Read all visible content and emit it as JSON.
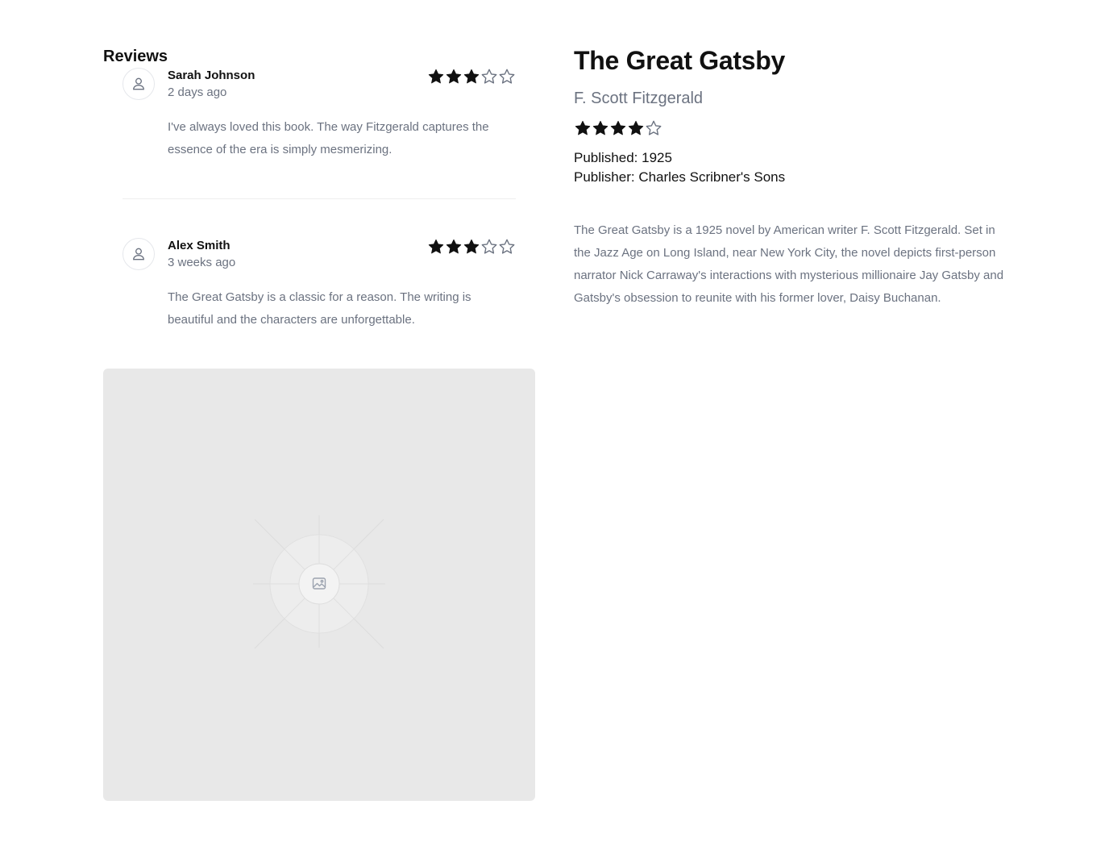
{
  "reviews_section": {
    "heading": "Reviews",
    "items": [
      {
        "name": "Sarah Johnson",
        "time": "2 days ago",
        "rating": 3,
        "max_rating": 5,
        "text": "I've always loved this book. The way Fitzgerald captures the essence of the era is simply mesmerizing."
      },
      {
        "name": "Alex Smith",
        "time": "3 weeks ago",
        "rating": 3,
        "max_rating": 5,
        "text": "The Great Gatsby is a classic for a reason. The writing is beautiful and the characters are unforgettable."
      }
    ]
  },
  "book": {
    "title": "The Great Gatsby",
    "author": "F. Scott Fitzgerald",
    "rating": 4,
    "max_rating": 5,
    "published": "Published: 1925",
    "publisher": "Publisher: Charles Scribner's Sons",
    "description": "The Great Gatsby is a 1925 novel by American writer F. Scott Fitzgerald. Set in the Jazz Age on Long Island, near New York City, the novel depicts first-person narrator Nick Carraway's interactions with mysterious millionaire Jay Gatsby and Gatsby's obsession to reunite with his former lover, Daisy Buchanan."
  },
  "colors": {
    "star_filled": "#111111",
    "star_empty": "#6b7280",
    "muted_text": "#6b7280",
    "placeholder_bg": "#e8e8e8"
  },
  "icons": {
    "avatar": "user-icon",
    "image": "image-placeholder-icon",
    "star_filled": "star-filled-icon",
    "star_empty": "star-outline-icon"
  }
}
